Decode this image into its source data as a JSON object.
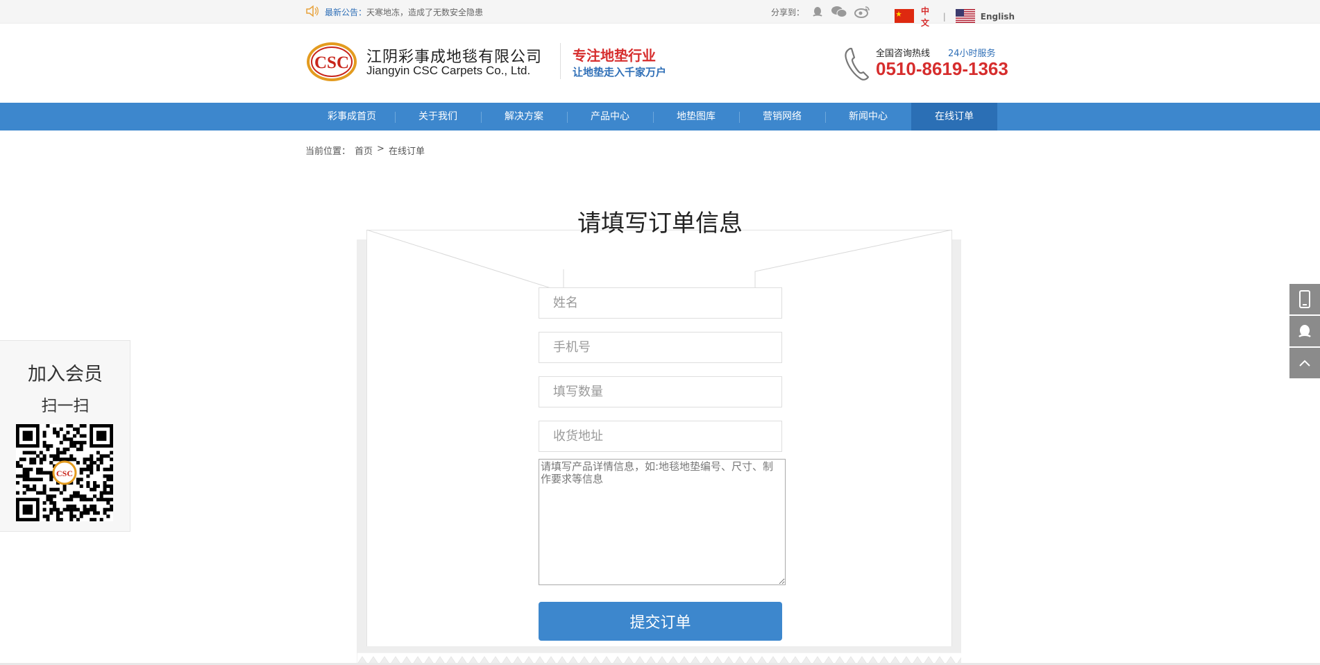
{
  "topbar": {
    "notice_label": "最新公告：",
    "notice_text": "天寒地冻，造成了无数安全隐患",
    "share_label": "分享到：",
    "share_icons": [
      "qq-icon",
      "wechat-icon",
      "weibo-icon"
    ],
    "lang_zh": "中文",
    "lang_sep": "|",
    "lang_en": "English"
  },
  "header": {
    "logo_text": "CSC",
    "company_cn": "江阴彩事成地毯有限公司",
    "company_en": "Jiangyin CSC Carpets Co., Ltd.",
    "slogan_main": "专注地垫行业",
    "slogan_sub": "让地垫走入千家万户",
    "hotline_label": "全国咨询热线",
    "hotline_service": "24小时服务",
    "hotline_number": "0510-8619-1363"
  },
  "nav": {
    "items": [
      {
        "label": "彩事成首页"
      },
      {
        "label": "关于我们"
      },
      {
        "label": "解决方案"
      },
      {
        "label": "产品中心"
      },
      {
        "label": "地垫图库"
      },
      {
        "label": "营销网络"
      },
      {
        "label": "新闻中心"
      },
      {
        "label": "在线订单"
      }
    ],
    "active_index": 7
  },
  "breadcrumb": {
    "prefix": "当前位置：",
    "home": "首页",
    "sep": ">",
    "current": "在线订单"
  },
  "form": {
    "title": "请填写订单信息",
    "name_placeholder": "姓名",
    "phone_placeholder": "手机号",
    "qty_placeholder": "填写数量",
    "address_placeholder": "收货地址",
    "detail_placeholder": "请填写产品详情信息，如:地毯地垫编号、尺寸、制作要求等信息",
    "submit_label": "提交订单"
  },
  "member": {
    "title": "加入会员",
    "scan": "扫一扫",
    "qr_logo": "CSC"
  },
  "colors": {
    "brand_blue": "#3d87cd",
    "brand_red": "#d62d2d",
    "active_nav": "#2b6fb5"
  }
}
